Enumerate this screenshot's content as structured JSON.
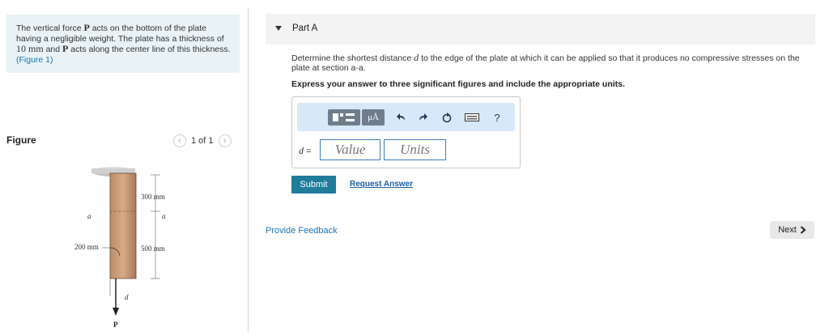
{
  "problem": {
    "line1_pre": "The vertical force ",
    "force_symbol": "P",
    "line1_post": " acts on the bottom of the plate having a negligible weight. The plate has a thickness of ",
    "thickness": "10 mm",
    "mid": " and ",
    "force_symbol2": "P",
    "end": " acts along the center line of this thickness. ",
    "figure_link": "(Figure 1)"
  },
  "figure_panel": {
    "title": "Figure",
    "pager_text": "1 of 1",
    "prev_icon": "chevron-left-icon",
    "next_icon": "chevron-right-icon",
    "labels": {
      "dim_300": "300 mm",
      "dim_500": "500 mm",
      "dim_200": "200 mm",
      "section_a_left": "a",
      "section_a_right": "a",
      "d": "d",
      "P": "P"
    }
  },
  "part": {
    "title": "Part A",
    "question_pre": "Determine the shortest distance ",
    "question_var": "d",
    "question_post": " to the edge of the plate at which it can be applied so that it produces no compressive stresses on the plate at section a-a.",
    "instruction": "Express your answer to three significant figures and include the appropriate units."
  },
  "answer": {
    "toolbar_icons": [
      "templates-icon",
      "mu-units-icon",
      "undo-icon",
      "redo-icon",
      "reset-icon",
      "keyboard-icon",
      "help-icon"
    ],
    "mu_label": "μÅ",
    "help_label": "?",
    "variable_label": "d",
    "equals": "=",
    "value_placeholder": "Value",
    "units_placeholder": "Units"
  },
  "actions": {
    "submit": "Submit",
    "request_answer": "Request Answer",
    "provide_feedback": "Provide Feedback",
    "next": "Next"
  },
  "colors": {
    "accent": "#1f7c9b",
    "link": "#1a73b5",
    "problem_bg": "#e9f3f6",
    "toolbar_bg": "#d7e8f8",
    "input_border": "#3f7cc0"
  }
}
